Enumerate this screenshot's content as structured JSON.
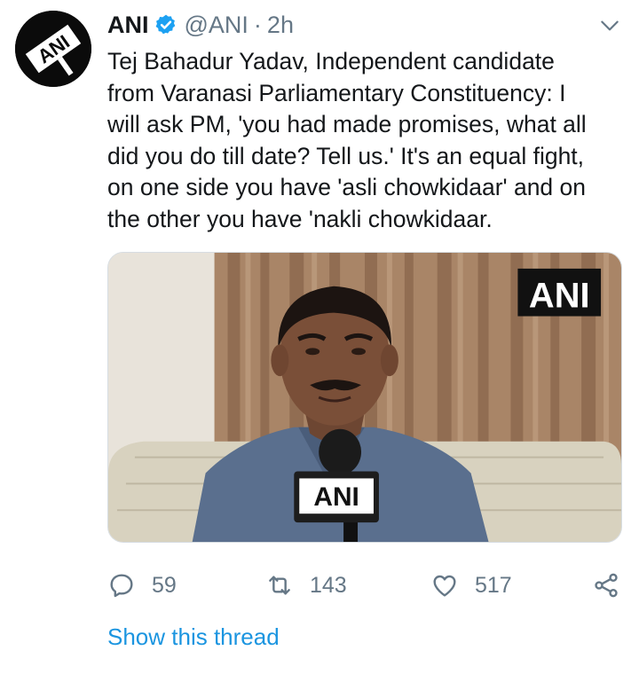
{
  "author": {
    "name": "ANI",
    "handle": "@ANI",
    "separator": "·",
    "time": "2h",
    "avatar_text": "ANI"
  },
  "tweet": {
    "lines": [
      "Tej Bahadur Yadav, Independent candidate",
      "from Varanasi Parliamentary Constituency: I",
      "will ask PM, 'you had made promises, what all",
      "did you do till date? Tell us.' It's an equal fight,",
      "on one side you have 'asli chowkidaar' and on",
      "the other you have 'nakli chowkidaar."
    ]
  },
  "media": {
    "watermark": "ANI",
    "mic_label": "ANI"
  },
  "actions": {
    "reply_count": "59",
    "retweet_count": "143",
    "like_count": "517"
  },
  "thread_link": "Show this thread",
  "colors": {
    "link": "#1b95e0",
    "muted": "#657786",
    "verified": "#1da1f2",
    "text": "#14171a"
  },
  "icons": [
    "verified-badge-icon",
    "chevron-down-icon",
    "reply-icon",
    "retweet-icon",
    "like-icon",
    "share-icon"
  ]
}
